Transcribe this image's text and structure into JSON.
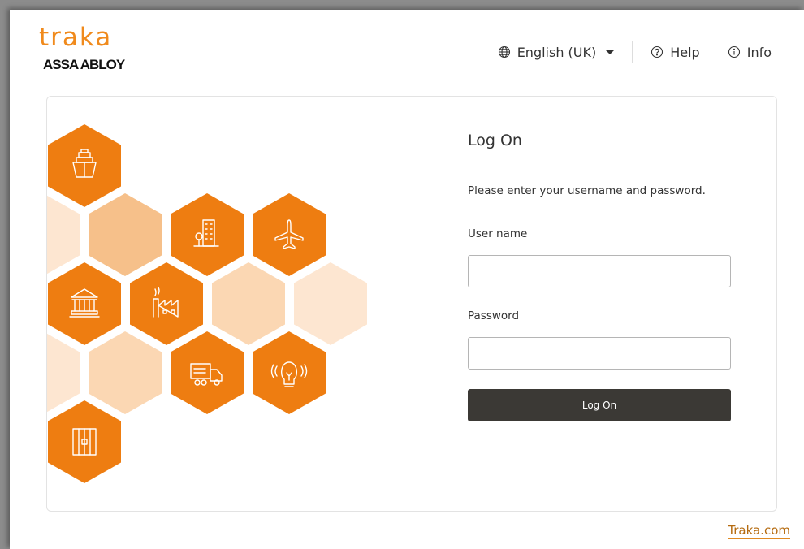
{
  "header": {
    "logo_brand": "traka",
    "logo_sub": "ASSA ABLOY",
    "language": {
      "label": "English (UK)",
      "icon": "globe-icon"
    },
    "help": {
      "label": "Help",
      "icon": "help-circle-icon"
    },
    "info": {
      "label": "Info",
      "icon": "info-circle-icon"
    }
  },
  "login": {
    "title": "Log On",
    "instructions": "Please enter your username and password.",
    "username_label": "User name",
    "username_value": "",
    "password_label": "Password",
    "password_value": "",
    "submit_label": "Log On"
  },
  "illustration": {
    "hex_icons": [
      "ship-icon",
      "building-icon",
      "airplane-icon",
      "government-building-icon",
      "factory-icon",
      "truck-icon",
      "lightbulb-icon",
      "prison-cell-icon"
    ]
  },
  "footer": {
    "link_label": "Traka.com"
  },
  "colors": {
    "brand_orange": "#ee7d11",
    "hex_light": "#f6c08a",
    "hex_pale": "#fbdcbd",
    "hex_faint": "#fde6d1",
    "button_dark": "#3b3935",
    "link": "#b56b10"
  }
}
